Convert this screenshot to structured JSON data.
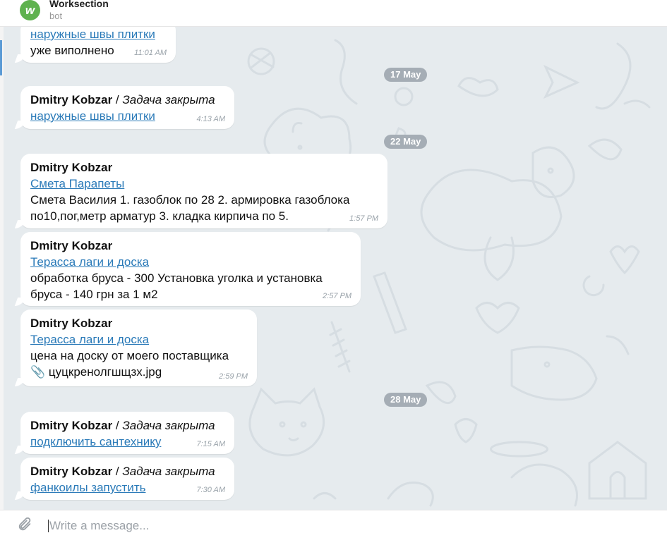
{
  "header": {
    "title": "Worksection",
    "subtitle": "bot",
    "avatar_letter": "w"
  },
  "date_separators": [
    "17 May",
    "22 May",
    "28 May"
  ],
  "messages": [
    {
      "link": "наружные швы плитки",
      "text": "уже виполнено",
      "time": "11:01 AM"
    },
    {
      "author": "Dmitry Kobzar",
      "separator": " / ",
      "action": "Задача закрыта",
      "link": "наружные швы плитки",
      "time": "4:13 AM"
    },
    {
      "author": "Dmitry Kobzar",
      "link": "Смета Парапеты",
      "text": "Смета Василия 1. газоблок по 28 2. армировка газоблока по10,пог,метр арматур 3. кладка кирпича по 5.",
      "time": "1:57 PM"
    },
    {
      "author": "Dmitry Kobzar",
      "link": "Терасса лаги и доска",
      "text": "обработка бруса - 300 Установка уголка и установка бруса - 140 грн за 1 м2",
      "time": "2:57 PM"
    },
    {
      "author": "Dmitry Kobzar",
      "link": "Терасса лаги и доска",
      "text": "цена на доску от моего поставщика",
      "attachment": "цуцкренолгшщзх.jpg",
      "time": "2:59 PM"
    },
    {
      "author": "Dmitry Kobzar",
      "separator": " / ",
      "action": "Задача закрыта",
      "link": "подключить сантехнику",
      "time": "7:15 AM"
    },
    {
      "author": "Dmitry Kobzar",
      "separator": " / ",
      "action": "Задача закрыта",
      "link": "фанкоилы запустить",
      "time": "7:30 AM"
    }
  ],
  "composer": {
    "placeholder": "Write a message..."
  },
  "icons": {
    "attachment_inline": "📎"
  },
  "colors": {
    "chat_background": "#e6ebee",
    "link": "#2a7ab8",
    "date_pill": "#a5adb5",
    "brand": "#5fb24f"
  }
}
